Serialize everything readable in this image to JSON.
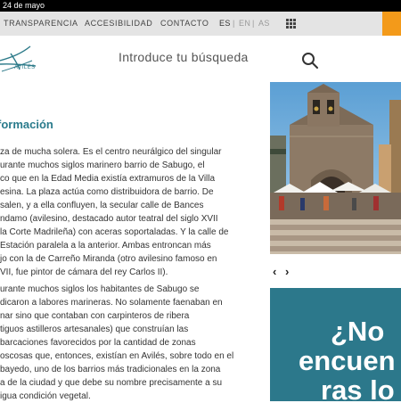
{
  "status_bar": {
    "date": "24 de mayo"
  },
  "top_nav": {
    "links": [
      {
        "label": "TRANSPARENCIA"
      },
      {
        "label": "ACCESIBILIDAD"
      },
      {
        "label": "CONTACTO"
      }
    ],
    "languages": [
      {
        "code": "ES",
        "active": true
      },
      {
        "code": "EN",
        "active": false
      },
      {
        "code": "AS",
        "active": false
      }
    ],
    "separator": "|",
    "apps_icon": "grid-icon",
    "accent_color": "#f39a1a"
  },
  "header": {
    "logo_text": "AVILÉS",
    "search_placeholder": "Introduce tu búsqueda",
    "search_icon": "search-icon"
  },
  "article": {
    "title": "formación",
    "paragraph1": [
      "za de mucha solera. Es el centro neurálgico del singular",
      "urante muchos siglos marinero barrio de Sabugo, el",
      "co que en la Edad Media existía extramuros de la Villa",
      "esina. La plaza actúa como distribuidora de barrio. De",
      "salen, y a ella confluyen, la secular calle de Bances",
      "ndamo (avilesino, destacado autor teatral del siglo XVII",
      "la Corte Madrileña) con aceras soportaladas. Y la calle de",
      "Estación paralela a la anterior. Ambas entroncan más",
      "jo con la de Carreño Miranda (otro avilesino famoso en",
      "VII, fue pintor de cámara del rey Carlos II)."
    ],
    "paragraph2": [
      "urante muchos siglos los habitantes de Sabugo se",
      "dicaron a labores marineras. No solamente faenaban en",
      "nar sino que contaban con carpinteros de ribera",
      "tiguos astilleros artesanales) que construían las",
      "barcaciones favorecidos por la cantidad de zonas",
      "oscosas que, entonces, existían en Avilés, sobre todo en el",
      "bayedo, uno de los barrios más tradicionales en la zona",
      "a de la ciudad y que debe su nombre precisamente a su",
      "igua condición vegetal."
    ]
  },
  "carousel": {
    "prev_icon": "‹",
    "next_icon": "›",
    "photo": "church-plaza-photo"
  },
  "cta": {
    "lines": [
      "¿No",
      "encuen",
      "ras lo"
    ],
    "background": "#2c788b"
  }
}
